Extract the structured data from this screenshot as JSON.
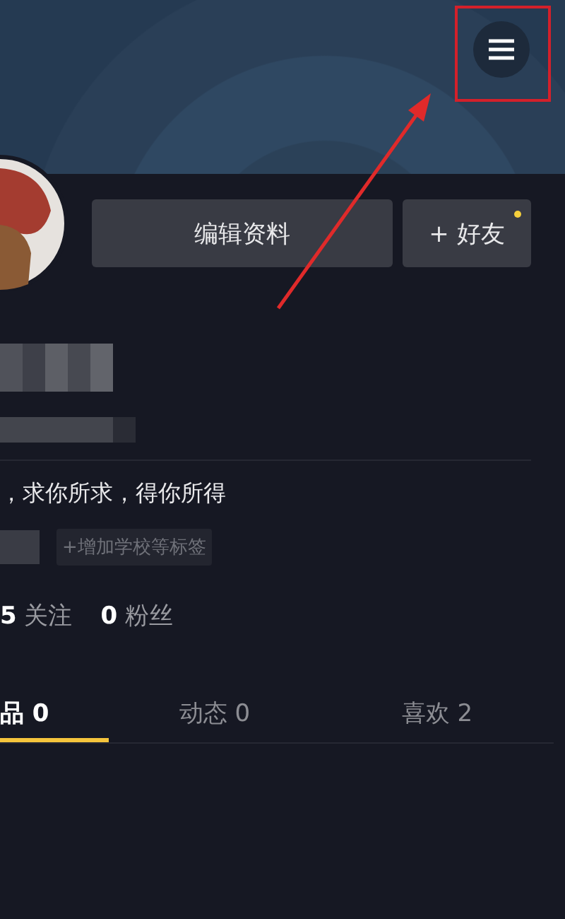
{
  "profile": {
    "edit_button": "编辑资料",
    "add_friend_button": {
      "label": "+ 好友",
      "badge": true
    }
  },
  "bio": "，求你所求，得你所得",
  "tag": "+增加学校等标签",
  "stats": [
    "**5** 关注",
    "**0** 粉丝"
  ],
  "tabs": [
    {
      "label": "品 0",
      "selected": true
    },
    {
      "label": "动态 0",
      "selected": false
    },
    {
      "label": "喜欢 2",
      "selected": false
    }
  ]
}
